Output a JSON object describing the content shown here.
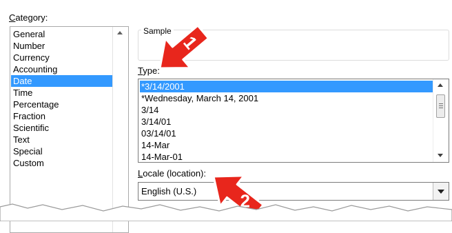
{
  "category": {
    "label": "Category:",
    "items": [
      "General",
      "Number",
      "Currency",
      "Accounting",
      "Date",
      "Time",
      "Percentage",
      "Fraction",
      "Scientific",
      "Text",
      "Special",
      "Custom"
    ],
    "selected_index": 4
  },
  "sample": {
    "label": "Sample"
  },
  "type": {
    "label": "Type:",
    "items": [
      "*3/14/2001",
      "*Wednesday, March 14, 2001",
      "3/14",
      "3/14/01",
      "03/14/01",
      "14-Mar",
      "14-Mar-01"
    ],
    "selected_index": 0
  },
  "locale": {
    "label": "Locale (location):",
    "value": "English (U.S.)"
  },
  "annotations": {
    "marker_1": "1",
    "marker_2": "2"
  },
  "colors": {
    "selection": "#3399ff",
    "arrow_fill": "#e8261c",
    "arrow_stroke": "#ffffff"
  }
}
